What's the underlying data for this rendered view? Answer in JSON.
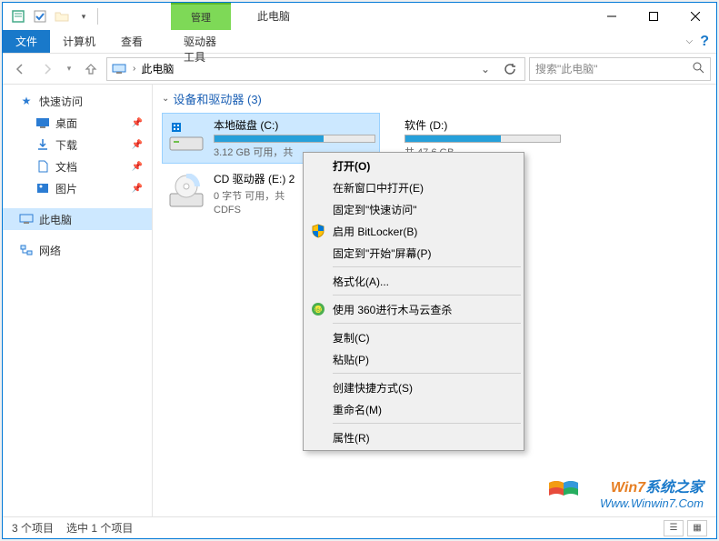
{
  "window": {
    "title": "此电脑",
    "manage_label": "管理"
  },
  "ribbon": {
    "file": "文件",
    "computer": "计算机",
    "view": "查看",
    "tool": "驱动器工具"
  },
  "address": {
    "location": "此电脑"
  },
  "search": {
    "placeholder": "搜索\"此电脑\""
  },
  "sidebar": {
    "quick": "快速访问",
    "items": [
      "桌面",
      "下载",
      "文档",
      "图片"
    ],
    "thispc": "此电脑",
    "network": "网络"
  },
  "group": {
    "header": "设备和驱动器 (3)"
  },
  "drives": [
    {
      "name": "本地磁盘 (C:)",
      "sub": "3.12 GB 可用，共",
      "fill_pct": 68
    },
    {
      "name": "软件 (D:)",
      "sub": "共 47.6 GB",
      "fill_pct": 62
    },
    {
      "name": "CD 驱动器 (E:) 2",
      "sub": "0 字节 可用，共",
      "sub2": "CDFS"
    }
  ],
  "context_menu": {
    "items": [
      {
        "label": "打开(O)",
        "bold": true
      },
      {
        "label": "在新窗口中打开(E)"
      },
      {
        "label": "固定到\"快速访问\""
      },
      {
        "label": "启用 BitLocker(B)",
        "icon": "shield"
      },
      {
        "label": "固定到\"开始\"屏幕(P)"
      },
      {
        "sep": true
      },
      {
        "label": "格式化(A)..."
      },
      {
        "sep": true
      },
      {
        "label": "使用 360进行木马云查杀",
        "icon": "360"
      },
      {
        "sep": true
      },
      {
        "label": "复制(C)"
      },
      {
        "label": "粘贴(P)"
      },
      {
        "sep": true
      },
      {
        "label": "创建快捷方式(S)"
      },
      {
        "label": "重命名(M)"
      },
      {
        "sep": true
      },
      {
        "label": "属性(R)"
      }
    ]
  },
  "status": {
    "count": "3 个项目",
    "selected": "选中 1 个项目"
  },
  "watermark": {
    "line1a": "Win7",
    "line1b": "系统之家",
    "line2": "Www.Winwin7.Com"
  }
}
